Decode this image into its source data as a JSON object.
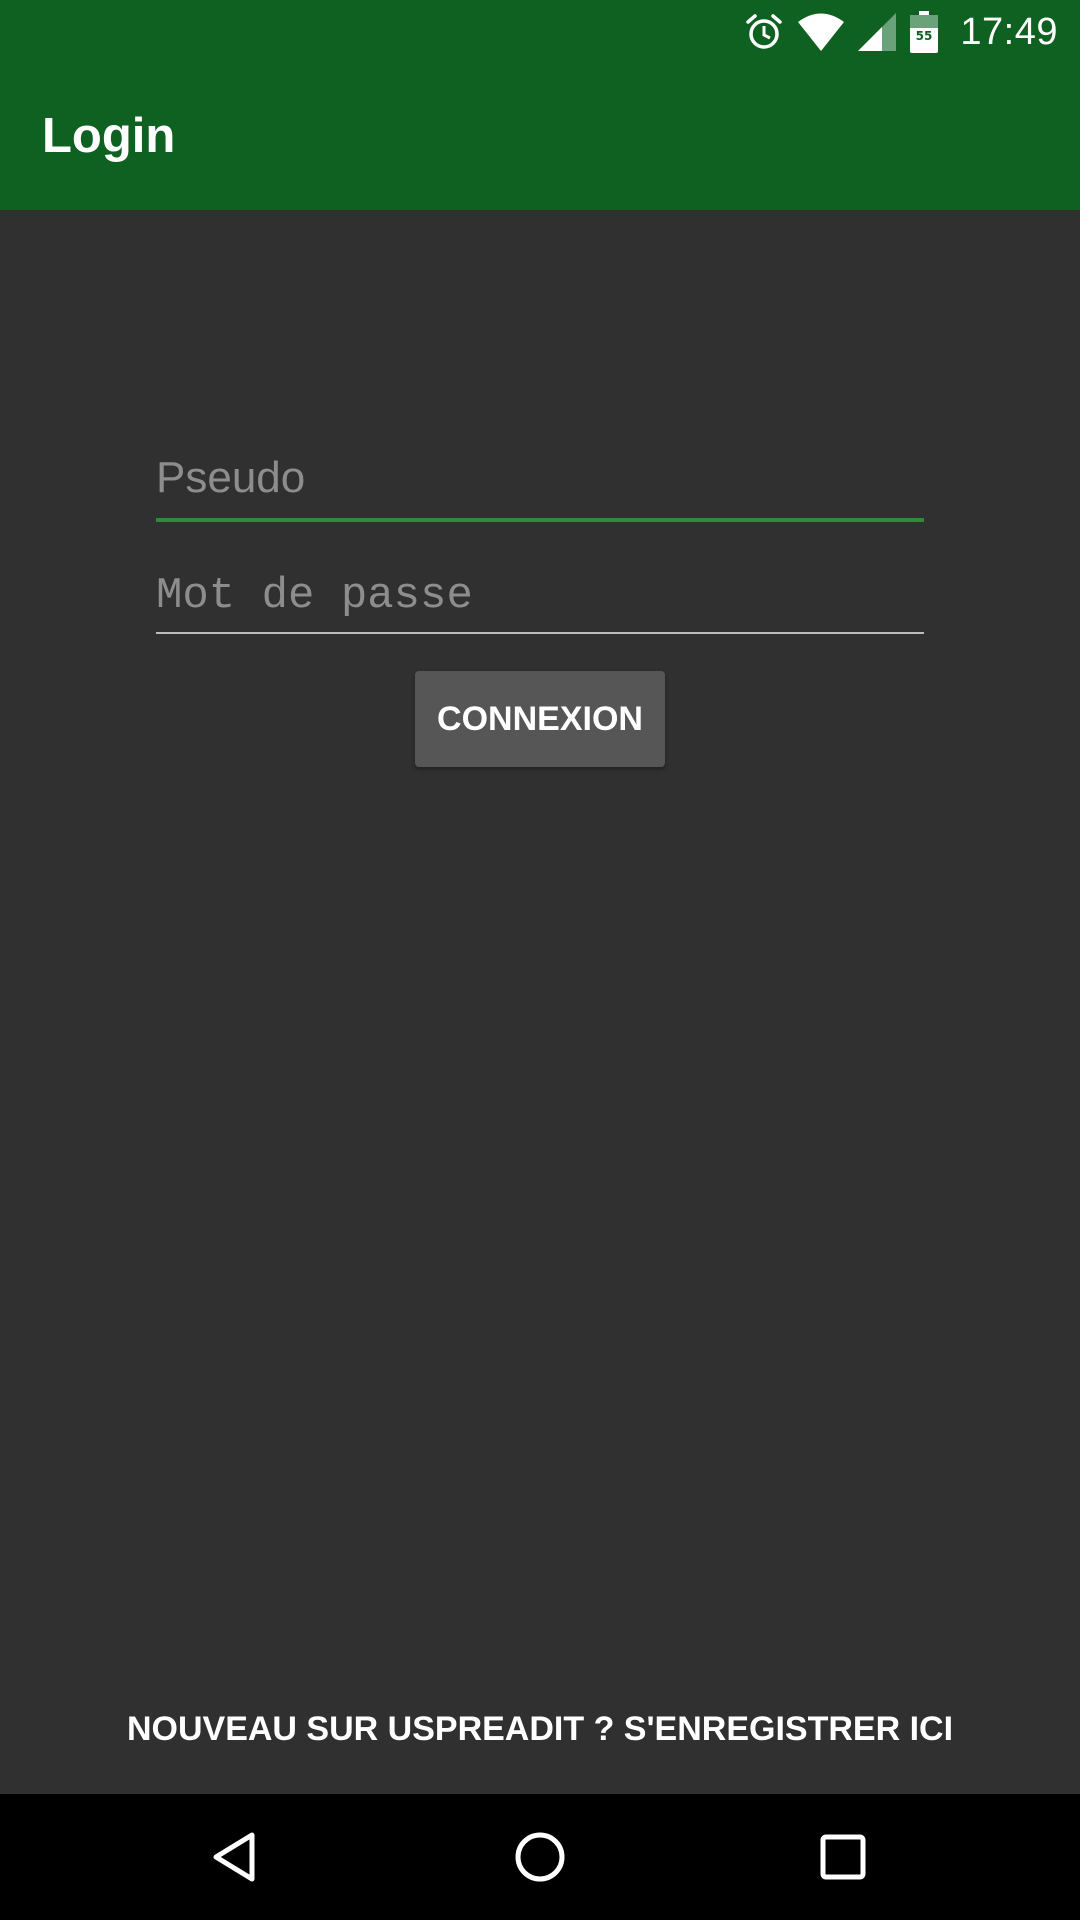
{
  "status_bar": {
    "time": "17:49",
    "battery_level": "55",
    "icons": [
      "alarm-icon",
      "wifi-icon",
      "cell-signal-icon",
      "battery-icon"
    ]
  },
  "app_bar": {
    "title": "Login",
    "color": "#0e6121"
  },
  "form": {
    "username_placeholder": "Pseudo",
    "username_value": "",
    "password_placeholder": "Mot de passe",
    "password_value": "",
    "submit_label": "CONNEXION"
  },
  "footer": {
    "register_link": "NOUVEAU SUR USPREADIT ? S'ENREGISTRER ICI"
  },
  "nav_bar": {
    "icons": [
      "back-icon",
      "home-icon",
      "recents-icon"
    ]
  },
  "colors": {
    "background": "#303030",
    "accent": "#2e8b3c",
    "button": "#565656"
  }
}
